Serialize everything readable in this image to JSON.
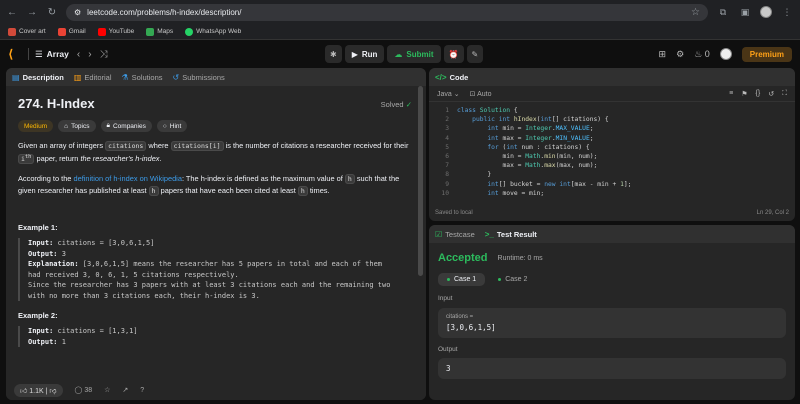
{
  "browser": {
    "url": "leetcode.com/problems/h-index/description/",
    "bookmarks": [
      "Cover art",
      "Gmail",
      "YouTube",
      "Maps",
      "WhatsApp Web"
    ]
  },
  "topbar": {
    "problem_list": "Array",
    "run": "Run",
    "submit": "Submit",
    "streak": "0",
    "premium": "Premium"
  },
  "desc_tabs": [
    "Description",
    "Editorial",
    "Solutions",
    "Submissions"
  ],
  "problem": {
    "title": "274. H-Index",
    "status": "Solved",
    "difficulty": "Medium",
    "chips": [
      "Topics",
      "Companies",
      "Hint"
    ],
    "p1_a": "Given an array of integers ",
    "p1_code1": "citations",
    "p1_b": " where ",
    "p1_code2": "citations[i]",
    "p1_c": " is the number of citations a researcher received for their ",
    "p1_code3": "i",
    "p1_sup": "th",
    "p1_d": " paper, return ",
    "p1_em": "the researcher's h-index",
    "p1_e": ".",
    "p2_a": "According to the ",
    "p2_link": "definition of h-index on Wikipedia",
    "p2_b": ": The h-index is defined as the maximum value of ",
    "p2_code1": "h",
    "p2_c": " such that the given researcher has published at least ",
    "p2_code2": "h",
    "p2_d": " papers that have each been cited at least ",
    "p2_code3": "h",
    "p2_e": " times.",
    "ex1_title": "Example 1:",
    "ex1_input_label": "Input:",
    "ex1_input": " citations = [3,0,6,1,5]",
    "ex1_output_label": "Output:",
    "ex1_output": " 3",
    "ex1_expl_label": "Explanation:",
    "ex1_expl": " [3,0,6,1,5] means the researcher has 5 papers in total and each of them\nhad received 3, 0, 6, 1, 5 citations respectively.\nSince the researcher has 3 papers with at least 3 citations each and the remaining two\nwith no more than 3 citations each, their h-index is 3.",
    "ex2_title": "Example 2:",
    "ex2_input_label": "Input:",
    "ex2_input": " citations = [1,3,1]",
    "ex2_output_label": "Output:",
    "ex2_output": " 1",
    "likes": "1.1K",
    "comments": "38"
  },
  "code": {
    "title": "Code",
    "language": "Java",
    "mode": "Auto",
    "saved": "Saved to local",
    "position": "Ln 29, Col 2"
  },
  "result": {
    "tabs": [
      "Testcase",
      "Test Result"
    ],
    "status": "Accepted",
    "runtime": "Runtime: 0 ms",
    "cases": [
      "Case 1",
      "Case 2"
    ],
    "input_label": "Input",
    "var_label": "citations =",
    "input_value": "[3,0,6,1,5]",
    "output_label": "Output",
    "output_value": "3"
  }
}
